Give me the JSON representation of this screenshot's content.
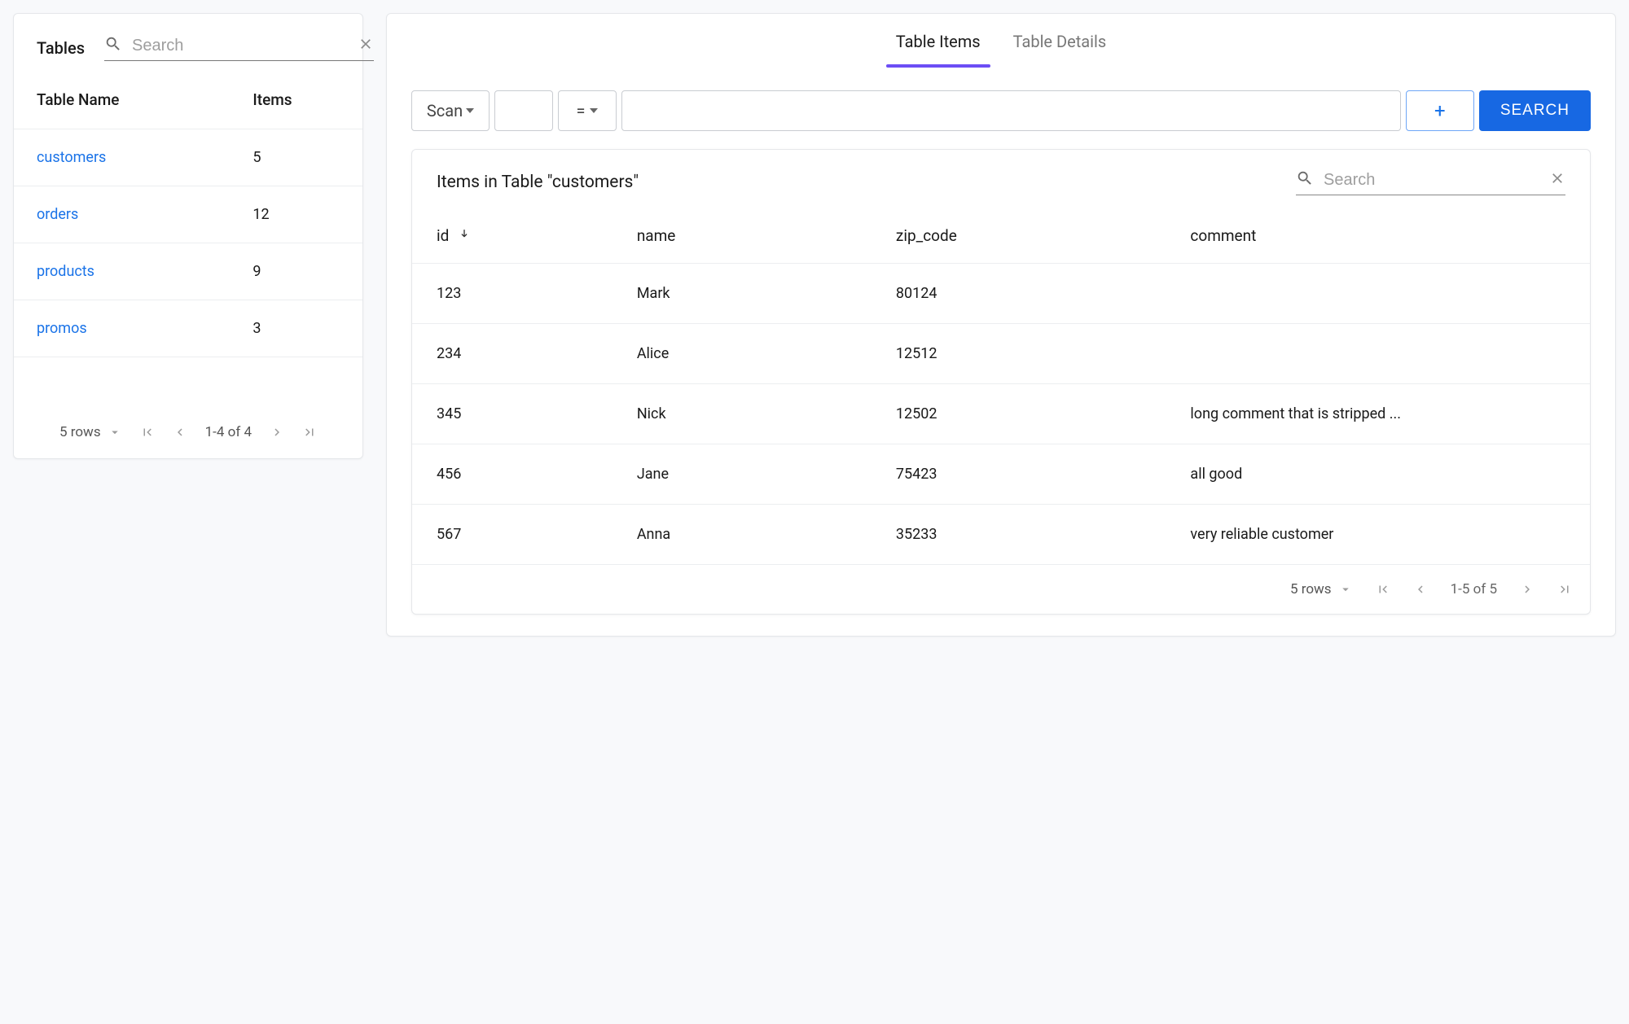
{
  "sidebar": {
    "title": "Tables",
    "search_placeholder": "Search",
    "columns": {
      "name": "Table Name",
      "items": "Items"
    },
    "rows": [
      {
        "name": "customers",
        "items": "5"
      },
      {
        "name": "orders",
        "items": "12"
      },
      {
        "name": "products",
        "items": "9"
      },
      {
        "name": "promos",
        "items": "3"
      }
    ],
    "footer": {
      "rows_label": "5 rows",
      "range": "1-4 of 4"
    }
  },
  "tabs": {
    "items": "Table Items",
    "details": "Table Details"
  },
  "query": {
    "mode": "Scan",
    "operator": "=",
    "add_label": "+",
    "search_label": "SEARCH"
  },
  "items_panel": {
    "title": "Items in Table \"customers\"",
    "search_placeholder": "Search",
    "columns": {
      "id": "id",
      "name": "name",
      "zip": "zip_code",
      "comment": "comment"
    },
    "rows": [
      {
        "id": "123",
        "name": "Mark",
        "zip": "80124",
        "comment": ""
      },
      {
        "id": "234",
        "name": "Alice",
        "zip": "12512",
        "comment": ""
      },
      {
        "id": "345",
        "name": "Nick",
        "zip": "12502",
        "comment": "long comment that is stripped ..."
      },
      {
        "id": "456",
        "name": "Jane",
        "zip": "75423",
        "comment": "all good"
      },
      {
        "id": "567",
        "name": "Anna",
        "zip": "35233",
        "comment": "very reliable customer"
      }
    ],
    "footer": {
      "rows_label": "5 rows",
      "range": "1-5 of 5"
    }
  }
}
